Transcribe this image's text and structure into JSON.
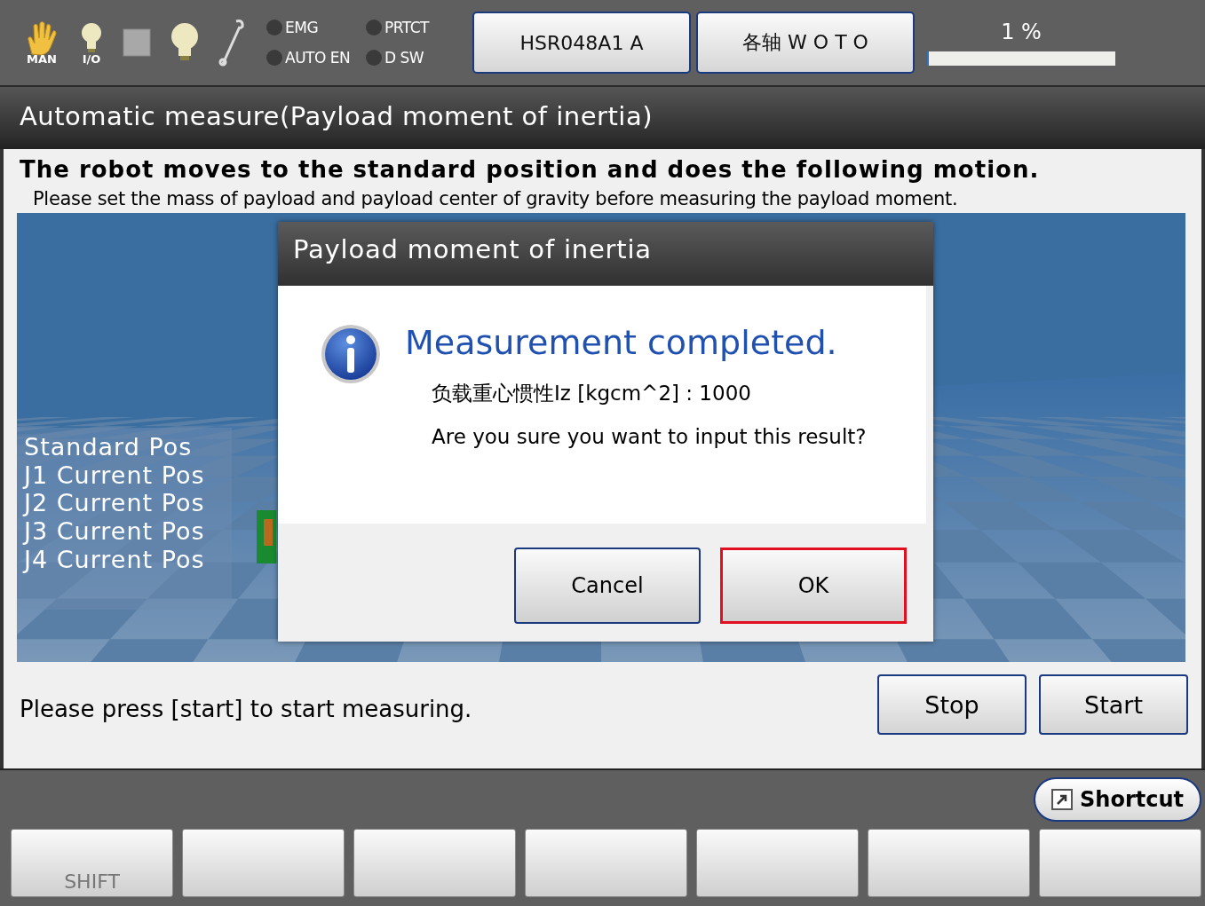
{
  "toolbar": {
    "mode_label": "MAN",
    "io_label": "I/O",
    "indicators": [
      {
        "label": "EMG",
        "on": false
      },
      {
        "label": "PRTCT",
        "on": false
      },
      {
        "label": "AUTO EN",
        "on": false
      },
      {
        "label": "D SW",
        "on": false
      }
    ],
    "robot_button": "HSR048A1 A",
    "axis_button": "各轴 W O T O",
    "speed": {
      "reading": "1 %",
      "level": 0.01
    }
  },
  "title": "Automatic measure(Payload moment of inertia)",
  "heading": "The robot moves to the standard position and does the following motion.",
  "subtitle": "Please set the mass of payload and payload center of gravity before measuring the payload moment.",
  "motion_steps": [
    "Standard Pos",
    "J1 Current Pos",
    "J2 Current Pos",
    "J3 Current Pos",
    "J4 Current Pos"
  ],
  "status_message": "Please press [start] to start measuring.",
  "action_buttons": [
    "Stop",
    "Start"
  ],
  "dialog": {
    "title": "Payload moment of inertia",
    "headline": "Measurement completed.",
    "result": "负载重心惯性Iz [kgcm^2] : 1000",
    "question": "Are you sure you want to input this result?",
    "buttons": [
      {
        "label": "Cancel",
        "selected": false
      },
      {
        "label": "OK",
        "selected": true
      }
    ]
  },
  "shortcut_button": "Shortcut",
  "function_keys": [
    {
      "kind": "labeled",
      "label": "SHIFT"
    },
    {
      "kind": "blank"
    },
    {
      "kind": "blank"
    },
    {
      "kind": "blank"
    },
    {
      "kind": "blank"
    },
    {
      "kind": "blank"
    },
    {
      "kind": "blank"
    }
  ]
}
